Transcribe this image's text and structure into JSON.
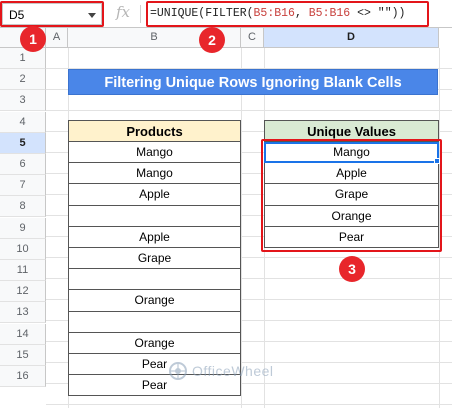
{
  "formula_bar": {
    "name_box": "D5",
    "fx_label": "fx",
    "formula_parts": [
      "=UNIQUE(FILTER(",
      "B5:B16",
      ", ",
      "B5:B16",
      " <> \"\"))"
    ]
  },
  "columns": [
    "A",
    "B",
    "C",
    "D"
  ],
  "rows": [
    "1",
    "2",
    "3",
    "4",
    "5",
    "6",
    "7",
    "8",
    "9",
    "10",
    "11",
    "12",
    "13",
    "14",
    "15",
    "16"
  ],
  "active": {
    "column": "D",
    "row": "5"
  },
  "title": "Filtering Unique Rows Ignoring Blank Cells",
  "products_table": {
    "header": "Products",
    "cells": [
      "Mango",
      "Mango",
      "Apple",
      "",
      "Apple",
      "Grape",
      "",
      "Orange",
      "",
      "Orange",
      "Pear",
      "Pear"
    ]
  },
  "unique_table": {
    "header": "Unique Values",
    "cells": [
      "Mango",
      "Apple",
      "Grape",
      "Orange",
      "Pear"
    ]
  },
  "annotations": [
    "1",
    "2",
    "3"
  ],
  "watermark": {
    "text": "OfficeWheel"
  },
  "colors": {
    "banner": "#4a86e8",
    "products_header_bg": "#fff2cc",
    "unique_header_bg": "#d9ead3",
    "annotation_red": "#e3151a",
    "selection_blue": "#1a73e8"
  }
}
